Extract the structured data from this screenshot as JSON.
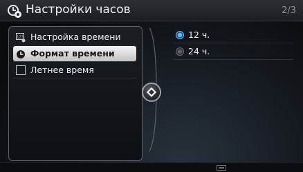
{
  "header": {
    "title": "Настройки часов",
    "page_indicator": "2/3",
    "icon": "clock-settings-icon"
  },
  "menu": {
    "items": [
      {
        "label": "Настройка времени",
        "icon": "time-setup-icon",
        "selected": false
      },
      {
        "label": "Формат времени",
        "icon": "clock-icon",
        "selected": true
      },
      {
        "label": "Летнее время",
        "icon": "checkbox-icon",
        "checked": false
      }
    ]
  },
  "options": {
    "items": [
      {
        "label": "12 ч.",
        "selected": true
      },
      {
        "label": "24 ч.",
        "selected": false
      }
    ]
  },
  "navigation": {
    "knob_icon": "left-right-arrows-icon"
  },
  "footer": {
    "icon": "keyboard-icon"
  },
  "colors": {
    "accent": "#59b8ff",
    "highlight": "#e6e6e6",
    "text": "#eef0f2"
  }
}
